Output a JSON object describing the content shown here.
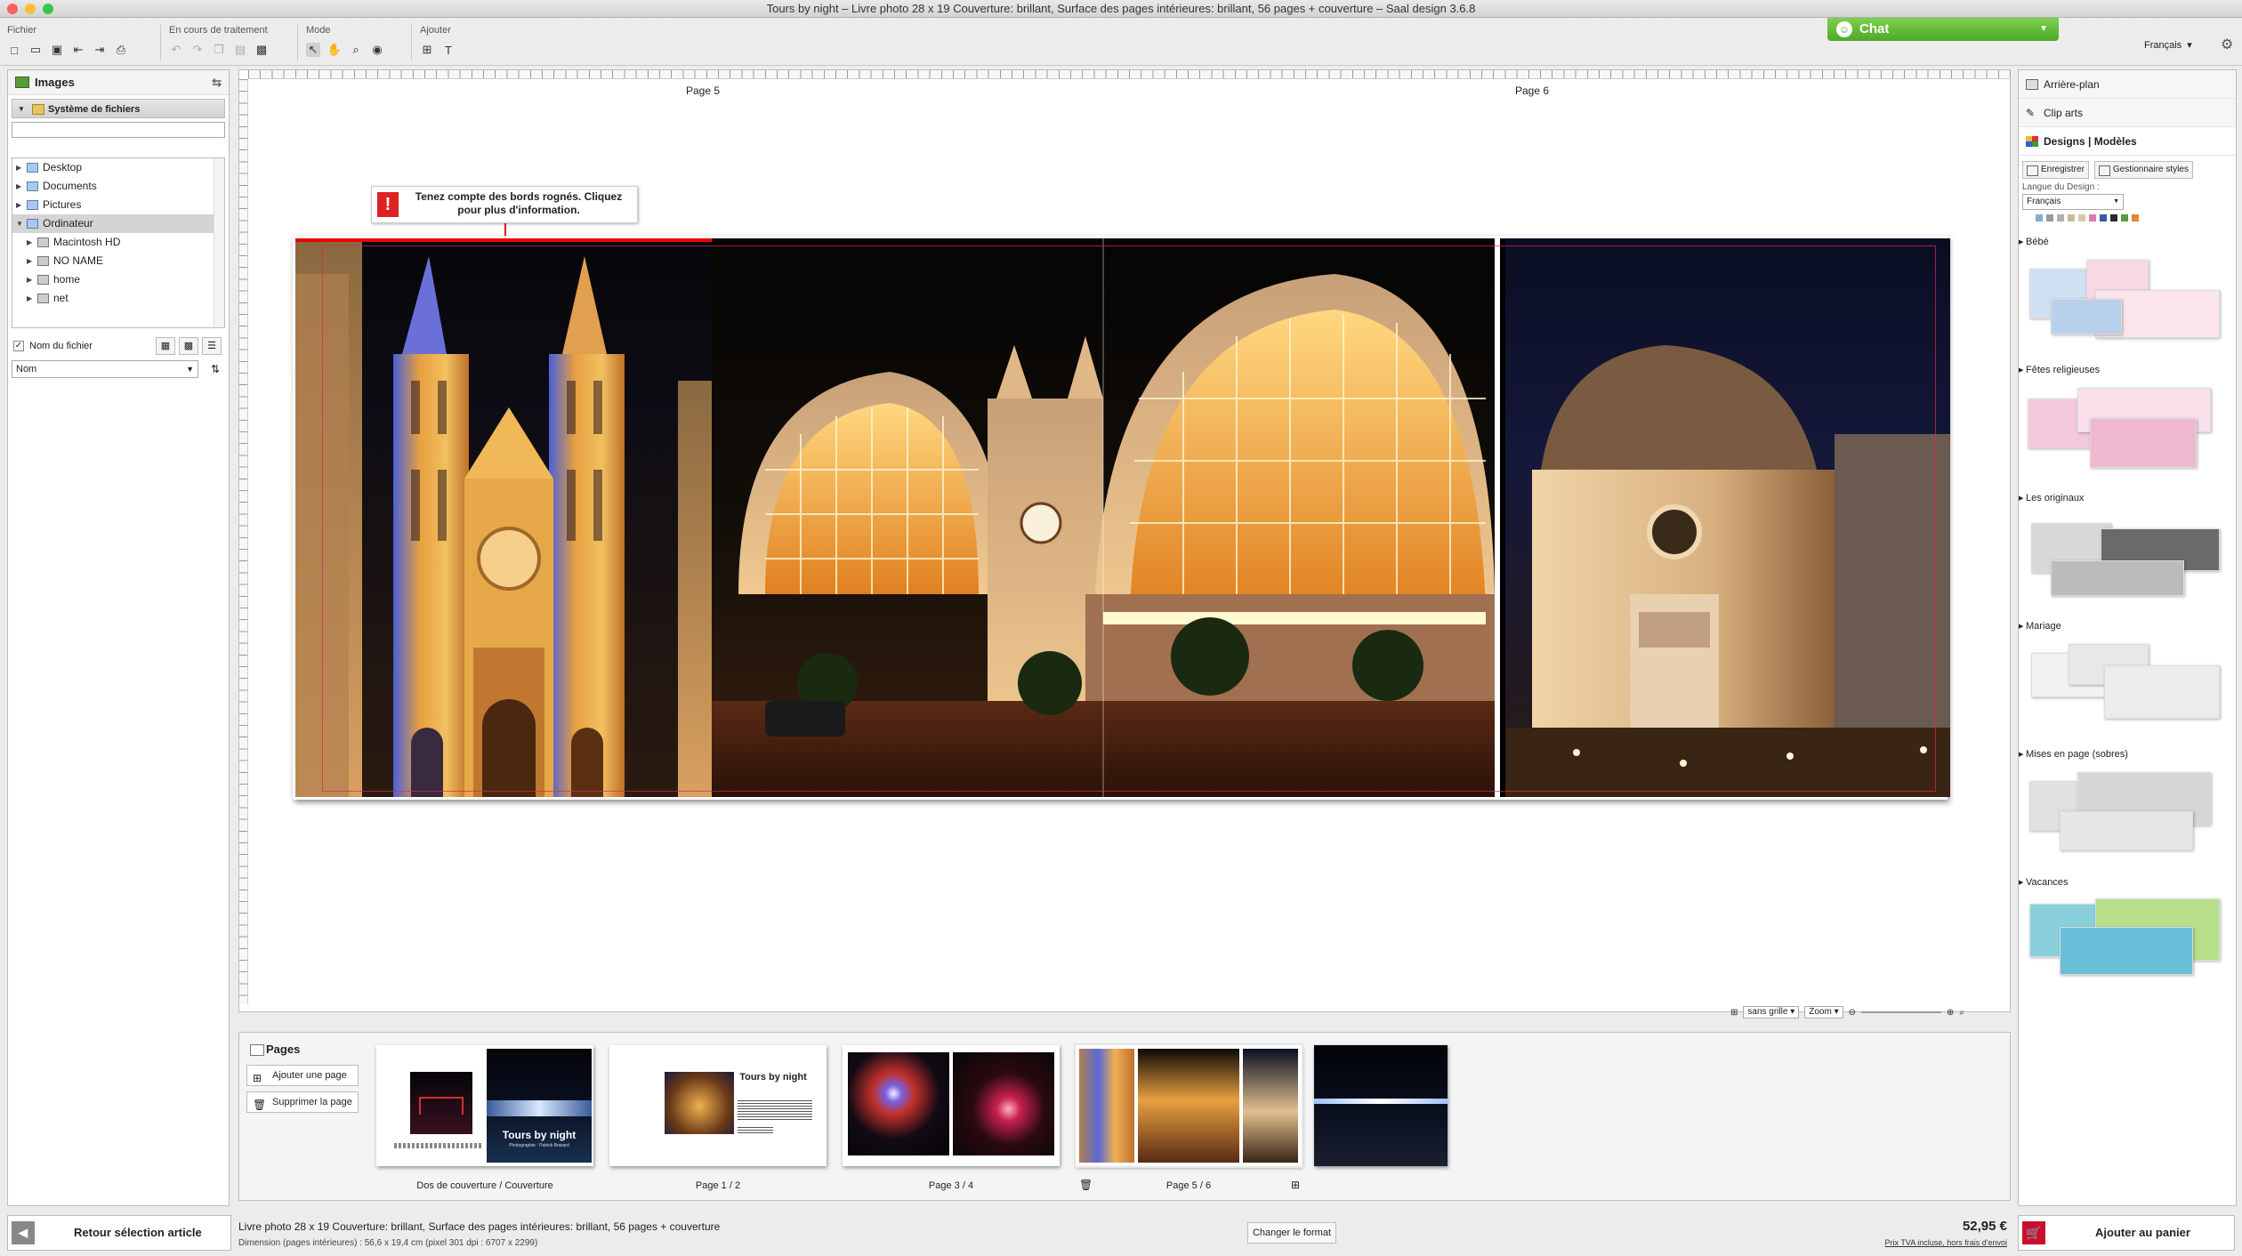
{
  "window": {
    "title": "Tours by night – Livre photo 28 x 19 Couverture: brillant, Surface des pages intérieures: brillant, 56 pages + couverture – Saal design 3.6.8"
  },
  "toolbar": {
    "groups": [
      "Fichier",
      "En cours de traitement",
      "Mode",
      "Ajouter"
    ],
    "chat": "Chat",
    "language": "Français"
  },
  "left_panel": {
    "title": "Images",
    "filesystem": "Système de fichiers",
    "tree": [
      {
        "label": "Desktop",
        "level": 0
      },
      {
        "label": "Documents",
        "level": 0
      },
      {
        "label": "Pictures",
        "level": 0
      },
      {
        "label": "Ordinateur",
        "level": 0,
        "selected": true
      },
      {
        "label": "Macintosh HD",
        "level": 1
      },
      {
        "label": "NO NAME",
        "level": 1
      },
      {
        "label": "home",
        "level": 1
      },
      {
        "label": "net",
        "level": 1
      }
    ],
    "filename_label": "Nom du fichier",
    "sort_value": "Nom"
  },
  "canvas": {
    "page_left": "Page 5",
    "page_right": "Page 6",
    "warning": "Tenez compte des bords rognés. Cliquez pour plus d'information.",
    "grid": "sans grille",
    "zoom": "Zoom"
  },
  "pages_panel": {
    "title": "Pages",
    "add": "Ajouter une page",
    "delete": "Supprimer la page",
    "thumbs": [
      {
        "caption": "Dos de couverture / Couverture",
        "cover_title": "Tours by night",
        "cover_sub": "Photographie : Patrick Boisard"
      },
      {
        "caption": "Page 1 / 2",
        "title": "Tours by night"
      },
      {
        "caption": "Page 3 / 4"
      },
      {
        "caption": "Page 5 / 6"
      }
    ]
  },
  "footer": {
    "back": "Retour sélection article",
    "product": "Livre photo 28 x 19 Couverture: brillant, Surface des pages intérieures: brillant, 56 pages + couverture",
    "dimension": "Dimension (pages intérieures) : 56,6 x 19,4 cm (pixel 301 dpi : 6707 x 2299)",
    "change_format": "Changer le format",
    "price": "52,95 €",
    "price_note": "Prix TVA incluse, hors frais d'envoi",
    "cart": "Ajouter au panier"
  },
  "right_panel": {
    "background": "Arrière-plan",
    "cliparts": "Clip arts",
    "designs": "Designs | Modèles",
    "save": "Enregistrer",
    "styles": "Gestionnaire styles",
    "design_lang_label": "Langue du Design :",
    "design_lang": "Français",
    "swatches": [
      "#ffffff",
      "#7fb0d8",
      "#9a9a9a",
      "#b0b0b0",
      "#c8b898",
      "#d8c8a8",
      "#e07aa8",
      "#3a5aa0",
      "#2a2a2a",
      "#5a9a3c",
      "#e08a30"
    ],
    "categories": [
      "Bébé",
      "Fêtes religieuses",
      "Les originaux",
      "Mariage",
      "Mises en page (sobres)",
      "Vacances"
    ]
  }
}
